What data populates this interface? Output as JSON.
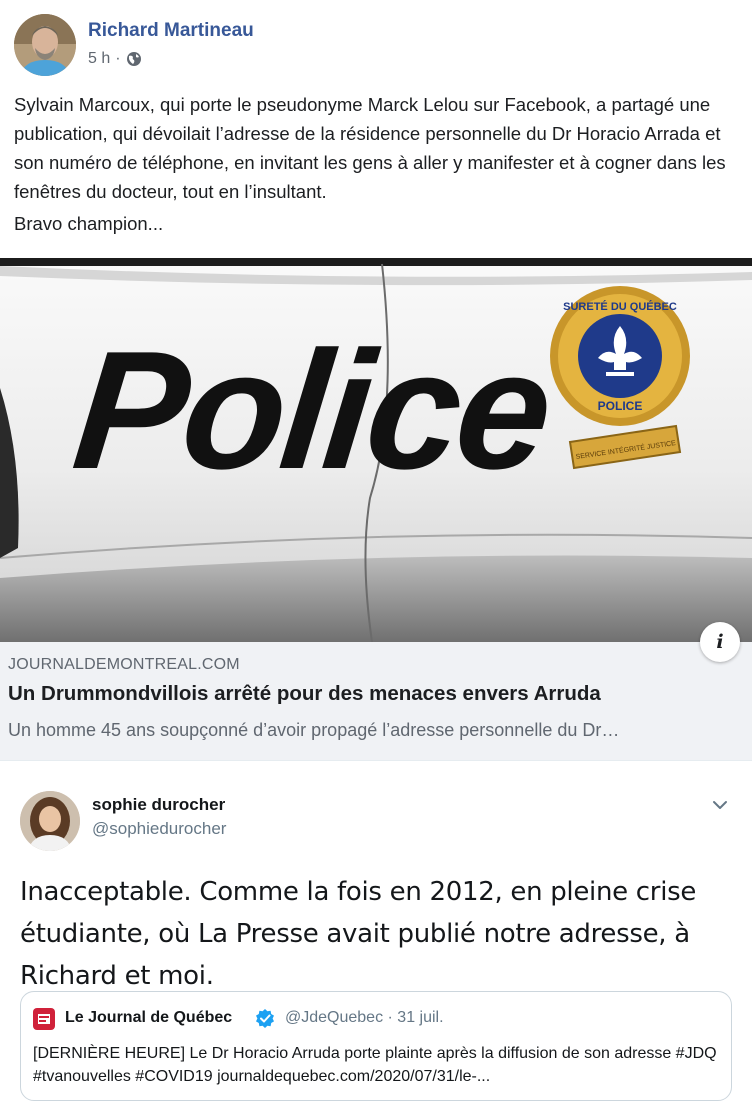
{
  "fb_post": {
    "author": "Richard Martineau",
    "time": "5 h",
    "separator": "·",
    "audience_icon": "globe-icon",
    "text": "Sylvain Marcoux, qui porte le pseudonyme Marck Lelou sur Facebook, a partagé une publication, qui dévoilait l’adresse de la résidence personnelle du Dr Horacio Arrada et son numéro de téléphone, en invitant les gens à aller y manifester et à cogner dans les fenêtres du docteur, tout en l’insultant.",
    "text2": "Bravo champion...",
    "photo": {
      "police_text": "Police",
      "badge_top": "SURETÉ DU QUÉBEC",
      "badge_bottom": "POLICE",
      "banner": "SERVICE INTÉGRITÉ JUSTICE"
    },
    "link": {
      "domain": "JOURNALDEMONTREAL.COM",
      "title": "Un Drummondvillois arrêté pour des menaces envers Arruda",
      "description": "Un homme 45 ans soupçonné d’avoir propagé l’adresse personnelle du Dr…",
      "info_label": "i"
    }
  },
  "tweet": {
    "name": "sophie durocher",
    "handle": "@sophiedurocher",
    "text": "Inacceptable. Comme la fois en 2012, en pleine crise étudiante, où La Presse avait publié notre adresse, à Richard et moi.",
    "quote": {
      "name": "Le Journal de Québec",
      "handle": "@JdeQuebec · 31 juil.",
      "text": "[DERNIÈRE HEURE] Le Dr Horacio Arruda porte plainte après la diffusion de son adresse #JDQ #tvanouvelles #COVID19 journaldequebec.com/2020/07/31/le-..."
    }
  },
  "colors": {
    "fb_link_blue": "#385898",
    "twitter_blue": "#1da1f2",
    "link_box_bg": "#f0f2f5",
    "badge_gold": "#d9a531",
    "badge_blue": "#1f3a8a",
    "police_text": "#111111"
  }
}
